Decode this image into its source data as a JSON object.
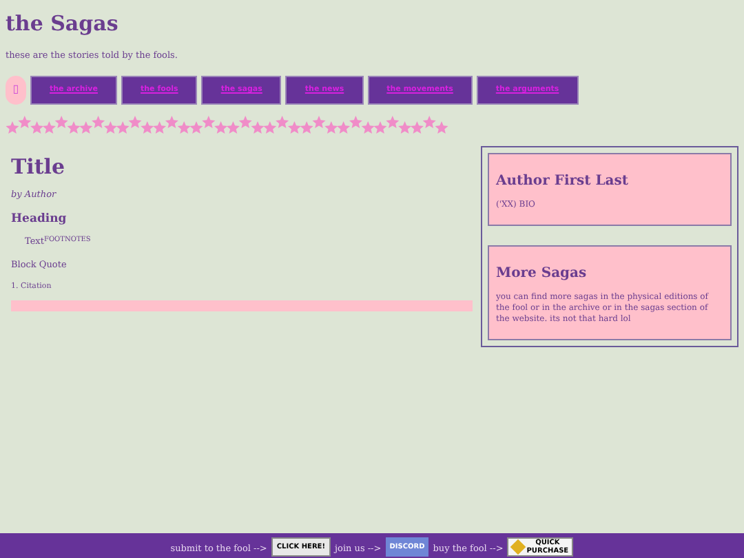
{
  "header": {
    "title": "the Sagas",
    "subtitle": "these are the stories told by the fools."
  },
  "nav": {
    "home_icon": "▯",
    "links": [
      {
        "label": "the archive"
      },
      {
        "label": "the fools"
      },
      {
        "label": "the sagas"
      },
      {
        "label": "the news"
      },
      {
        "label": "the movements"
      },
      {
        "label": "the arguments"
      }
    ]
  },
  "article": {
    "title": "Title",
    "byline": "by Author",
    "heading": "Heading",
    "text": "Text$^{FOOTNOTES}$",
    "block_quote": "Block Quote",
    "citation": "1. Citation"
  },
  "sidebar": [
    {
      "title": "Author First Last",
      "body": "('XX) BIO"
    },
    {
      "title": "More Sagas",
      "body": "you can find more sagas in the physical editions of the fool or in the archive or in the sagas section of the website. its not that hard lol"
    }
  ],
  "footer": [
    {
      "text": "submit to the fool -->",
      "button": "CLICK HERE!",
      "kind": "click"
    },
    {
      "text": "join us -->",
      "button": "DISCORD",
      "kind": "discord"
    },
    {
      "text": "buy the fool -->",
      "button": "QUICK PURCHASE",
      "kind": "purchase"
    }
  ]
}
